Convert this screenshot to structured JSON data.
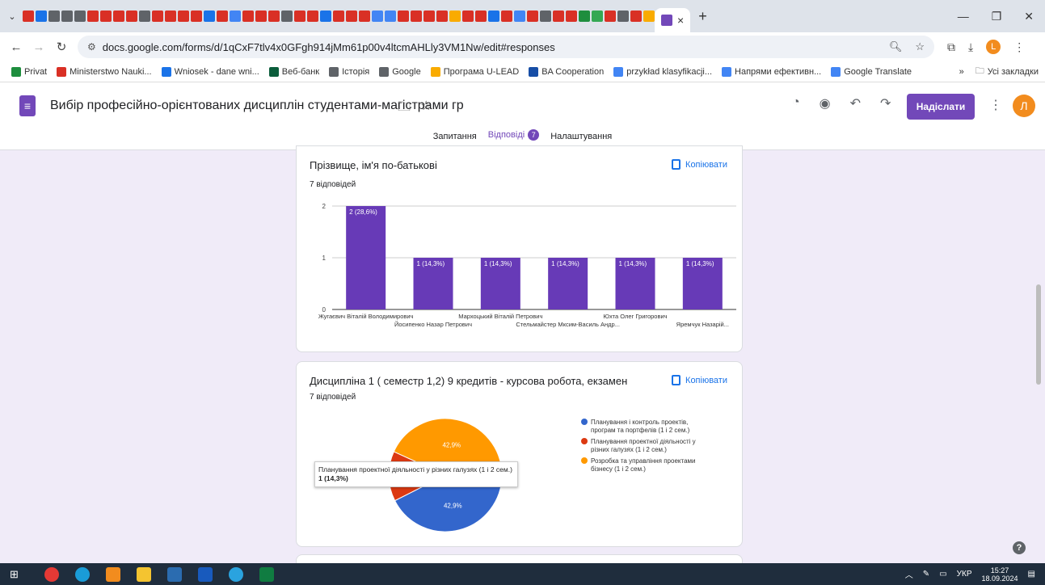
{
  "browser": {
    "tab_close": "×",
    "new_tab": "+",
    "url": "docs.google.com/forms/d/1qCxF7tlv4x0GFgh914jMm61p00v4ltcmAHLly3VM1Nw/edit#responses",
    "profile_letter": "L",
    "bookmarks": [
      {
        "label": "Privat",
        "color": "#1e8e3e"
      },
      {
        "label": "Ministerstwo Nauki...",
        "color": "#d93025"
      },
      {
        "label": "Wniosek - dane wni...",
        "color": "#1a73e8"
      },
      {
        "label": "Веб-банк",
        "color": "#0b5d3b"
      },
      {
        "label": "Історія",
        "color": "#5f6368"
      },
      {
        "label": "Google",
        "color": "#5f6368"
      },
      {
        "label": "Програма U-LEAD",
        "color": "#f9ab00"
      },
      {
        "label": "BA Cooperation",
        "color": "#174ea6"
      },
      {
        "label": "przykład klasyfikacji...",
        "color": "#4285f4"
      },
      {
        "label": "Напрями ефективн...",
        "color": "#4285f4"
      },
      {
        "label": "Google Translate",
        "color": "#4285f4"
      }
    ],
    "bookmarks_more": "»",
    "all_bookmarks": "Усі закладки"
  },
  "forms": {
    "title": "Вибір професійно-орієнтованих дисциплін студентами-магістрами гр",
    "send_label": "Надіслати",
    "avatar_letter": "Л",
    "tabs": [
      {
        "label": "Запитання"
      },
      {
        "label": "Відповіді",
        "badge": "7"
      },
      {
        "label": "Налаштування"
      }
    ]
  },
  "card1": {
    "title": "Прізвище, ім'я по-батькові",
    "responses": "7 відповідей",
    "copy_label": "Копіювати"
  },
  "card2": {
    "title": "Дисципліна 1 ( семестр 1,2) 9 кредитів - курсова робота, екзамен",
    "responses": "7 відповідей",
    "copy_label": "Копіювати",
    "tooltip_title": "Планування проектної діяльності у різних галузях (1 і 2 сем.)",
    "tooltip_value": "1 (14,3%)"
  },
  "taskbar": {
    "lang": "УКР",
    "time": "15:27",
    "date": "18.09.2024"
  },
  "chart_data": [
    {
      "type": "bar",
      "categories": [
        "Жугаєвич Віталій Володимирович",
        "Йосипенко Назар Петрович",
        "Мархоцький Віталій Петрович",
        "Стельмайстер Мксим-Василь Андр...",
        "Юхта Олег Григорович",
        "Яремчук Назарій..."
      ],
      "values": [
        2,
        1,
        1,
        1,
        1,
        1
      ],
      "data_labels": [
        "2 (28,6%)",
        "1 (14,3%)",
        "1 (14,3%)",
        "1 (14,3%)",
        "1 (14,3%)",
        "1 (14,3%)"
      ],
      "ylim": [
        0,
        2
      ],
      "yticks": [
        0,
        1,
        2
      ],
      "color": "#673ab7",
      "grid": true
    },
    {
      "type": "pie",
      "slices": [
        {
          "label": "Планування і контроль проектів, програм та портфелів (1 і 2 сем.)",
          "value": 3,
          "percent_label": "42,9%",
          "color": "#3366cc"
        },
        {
          "label": "Планування проектної діяльності у різних галузях (1 і 2 сем.)",
          "value": 1,
          "percent_label": "",
          "color": "#dc3912"
        },
        {
          "label": "Розробка та управління проектами бізнесу (1 і 2 сем.)",
          "value": 3,
          "percent_label": "42,9%",
          "color": "#ff9900"
        }
      ],
      "legend_position": "right"
    }
  ]
}
